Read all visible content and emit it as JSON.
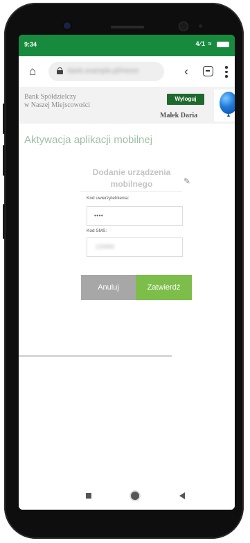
{
  "status_bar": {
    "time": "9:34",
    "signal_label": "4⁄1",
    "wifi_icon": "wifi-icon",
    "battery_icon": "battery-icon"
  },
  "browser": {
    "url": "bank.example.pl/Home",
    "home_icon": "home-icon",
    "lock_icon": "lock-icon",
    "share_icon": "share-icon",
    "tabs_icon": "tabs-icon",
    "menu_icon": "menu-icon"
  },
  "bank_header": {
    "name_line1": "Bank Spółdzielczy",
    "name_line2": "w Naszej Miejscowości",
    "logout_label": "Wyloguj",
    "user_name": "Małek Daria",
    "logo_icon": "balloon-logo-icon"
  },
  "page": {
    "title": "Aktywacja aplikacji mobilnej"
  },
  "form": {
    "title_line1": "Dodanie urządzenia",
    "title_line2": "mobilnego",
    "edit_icon": "pencil-icon",
    "auth_code_label": "Kod uwierzytelnienia:",
    "auth_code_value": "••••",
    "sms_code_label": "Kod SMS:",
    "sms_code_value": "123456"
  },
  "buttons": {
    "cancel_label": "Anuluj",
    "confirm_label": "Zatwierdź"
  },
  "colors": {
    "status_bar": "#188a3e",
    "logout_button": "#1e6a2c",
    "confirm_button": "#7dbd4a",
    "cancel_button": "#a7a7a7",
    "page_title": "#9fbfa4"
  }
}
